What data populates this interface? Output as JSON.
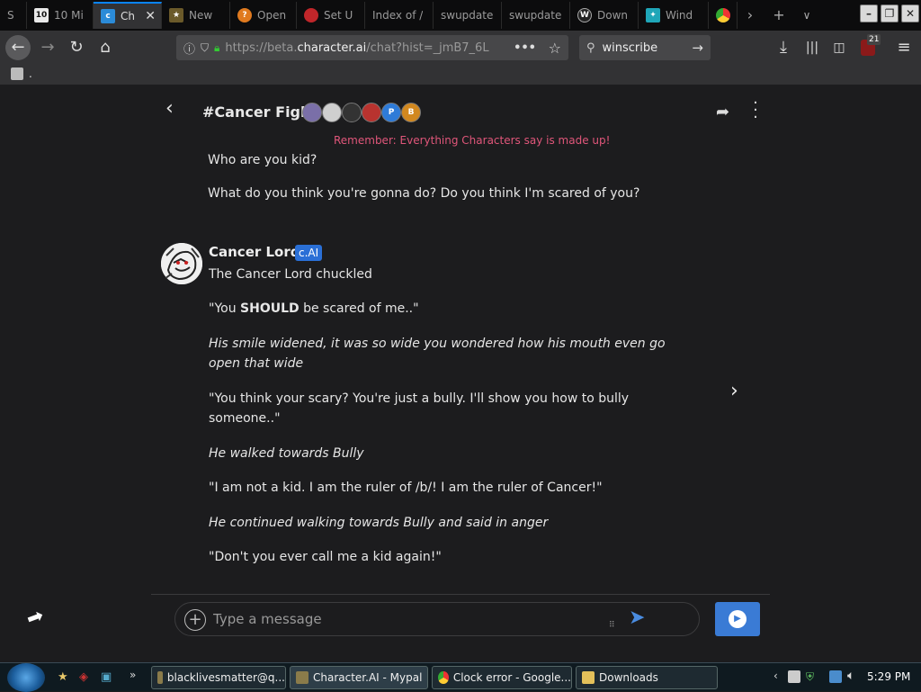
{
  "browser": {
    "tabs": [
      {
        "label": "S",
        "icon": "generic-tab-icon"
      },
      {
        "label": "10 Mi",
        "icon": "ten-favicon-icon"
      },
      {
        "label": "Ch",
        "icon": "character-ai-favicon-icon",
        "active": true
      },
      {
        "label": "New",
        "icon": "mypal-favicon-icon"
      },
      {
        "label": "Open",
        "icon": "firefox-favicon-icon"
      },
      {
        "label": "Set U",
        "icon": "red-lips-favicon-icon"
      },
      {
        "label": "Index of /",
        "icon": "none"
      },
      {
        "label": "swupdate",
        "icon": "none"
      },
      {
        "label": "swupdate",
        "icon": "none"
      },
      {
        "label": "Down",
        "icon": "w-favicon-icon"
      },
      {
        "label": "Wind",
        "icon": "windscribe-favicon-icon"
      }
    ],
    "url_host_prefix": "https://beta.",
    "url_host_domain": "character.ai",
    "url_rest": "/chat?hist=_jmB7_6L",
    "search_value": "winscribe",
    "notification_badge": "21",
    "bookmark_label": "."
  },
  "chat": {
    "title": "#Cancer Fight",
    "participants": [
      {
        "initial": "",
        "color": "#7a6fa8"
      },
      {
        "initial": "",
        "color": "#cfcfcf"
      },
      {
        "initial": "",
        "color": "#333333"
      },
      {
        "initial": "",
        "color": "#b8332f"
      },
      {
        "initial": "P",
        "color": "#2e7bd8"
      },
      {
        "initial": "B",
        "color": "#d2881f"
      }
    ],
    "disclaimer": "Remember: Everything Characters say is made up!",
    "prev_message": {
      "lines": [
        "Who are you kid?",
        "What do you think you're gonna do?  Do you think I'm scared of you?"
      ]
    },
    "message": {
      "sender": "Cancer Lord",
      "badge": "c.AI",
      "paragraphs": [
        {
          "text": "The Cancer Lord chuckled",
          "italic": true
        },
        {
          "pre": "\"You ",
          "bold": "SHOULD",
          "post": " be scared of me..\""
        },
        {
          "text": "His smile widened, it was so wide you wondered how his mouth even go open that wide",
          "italic": true
        },
        {
          "text": "\"You think your scary? You're just a bully. I'll show you how to bully someone..\"",
          "italic": false
        },
        {
          "text": "He walked towards Bully",
          "italic": true
        },
        {
          "text": "\"I am not a kid. I am the ruler of /b/! I am the ruler of Cancer!\"",
          "italic": false
        },
        {
          "text": "He continued walking towards Bully and said in anger",
          "italic": true
        },
        {
          "text": "\"Don't you ever call me a kid again!\"",
          "italic": false
        }
      ]
    },
    "input_placeholder": "Type a message"
  },
  "taskbar": {
    "items": [
      {
        "label": "blacklivesmatter@q...",
        "icon": "mypal-task-icon"
      },
      {
        "label": "Character.AI - Mypal",
        "icon": "mypal-task-icon",
        "active": true
      },
      {
        "label": "Clock error - Google...",
        "icon": "chrome-task-icon"
      },
      {
        "label": "Downloads",
        "icon": "folder-task-icon"
      }
    ],
    "clock": "5:29 PM"
  },
  "colors": {
    "accent": "#3a7bd5",
    "disclaimer": "#e0567a",
    "badge": "#2a6fd6"
  }
}
